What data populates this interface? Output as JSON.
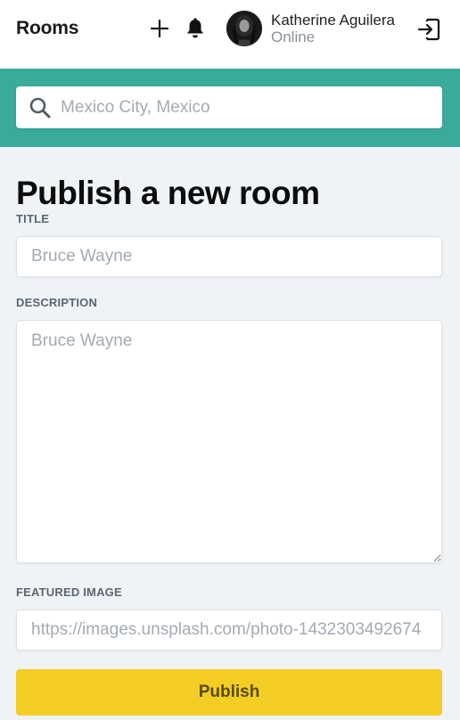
{
  "header": {
    "brand": "Rooms",
    "add_icon": "plus-icon",
    "notifications_icon": "bell-icon",
    "user": {
      "name": "Katherine Aguilera",
      "status": "Online"
    },
    "logout_icon": "logout-icon"
  },
  "search": {
    "placeholder": "Mexico City, Mexico",
    "icon": "search-icon",
    "band_color": "#3aab9b"
  },
  "form": {
    "title": "Publish a new room",
    "fields": {
      "title": {
        "label": "TITLE",
        "placeholder": "Bruce Wayne",
        "value": ""
      },
      "description": {
        "label": "DESCRIPTION",
        "placeholder": "Bruce Wayne",
        "value": ""
      },
      "featured_image": {
        "label": "FEATURED IMAGE",
        "placeholder": "https://images.unsplash.com/photo-1432303492674",
        "value": ""
      }
    },
    "submit_label": "Publish",
    "submit_color": "#f3cd23"
  }
}
